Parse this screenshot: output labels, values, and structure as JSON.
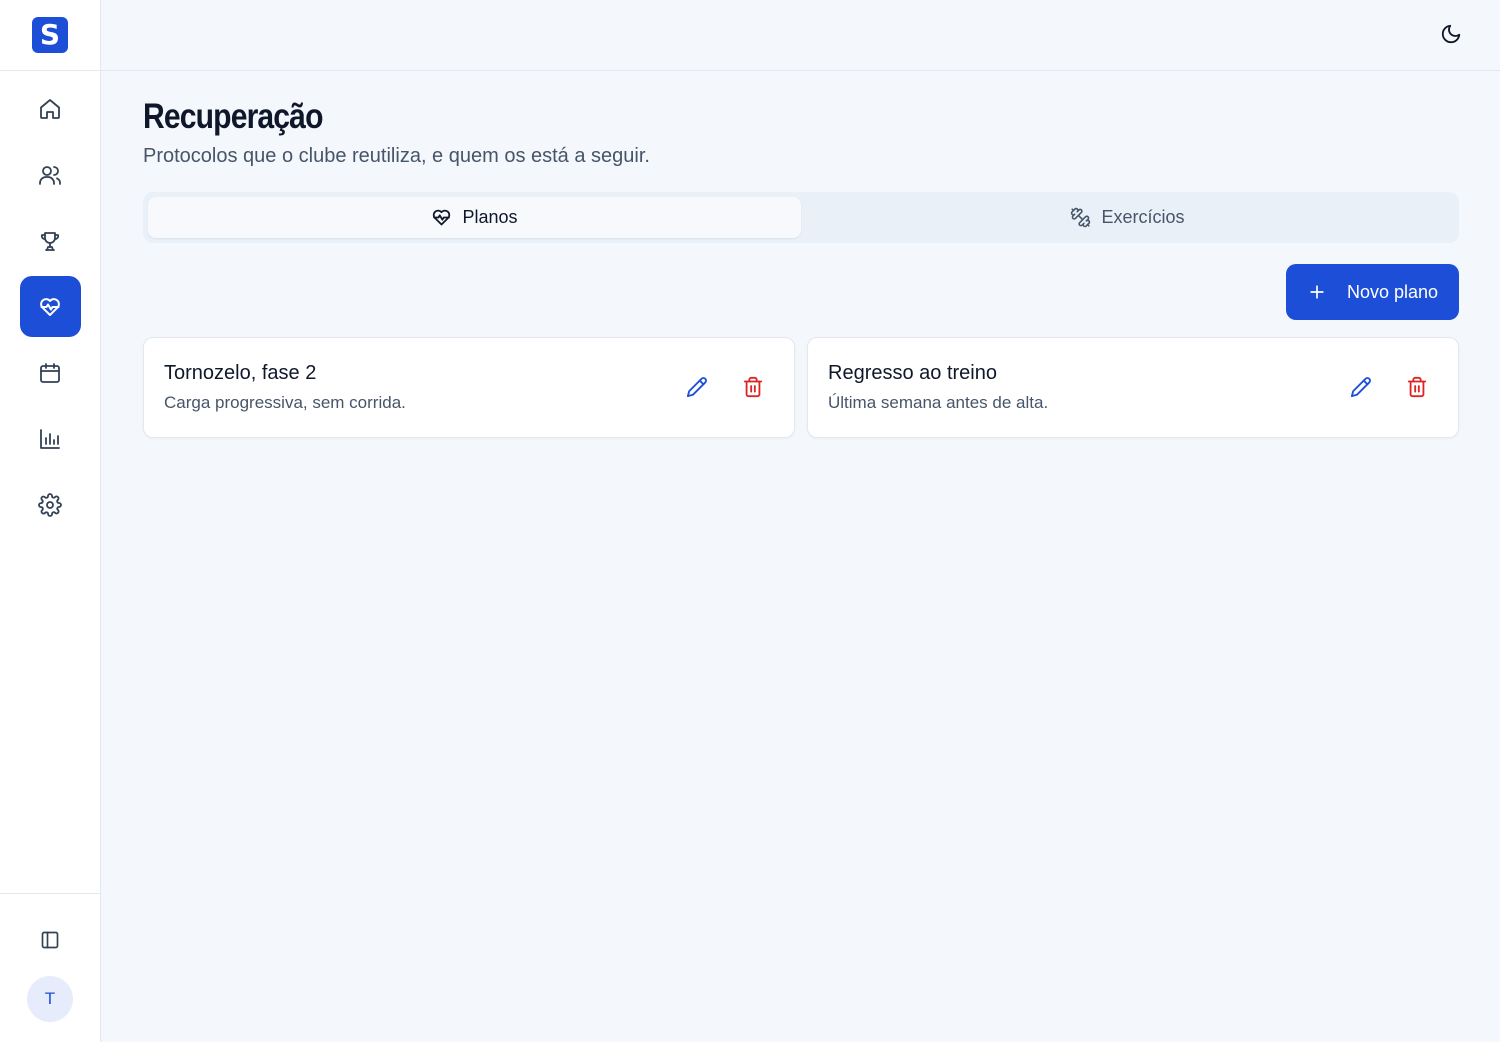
{
  "sidebar": {
    "logo": "S",
    "nav": [
      {
        "icon": "home-icon",
        "active": false
      },
      {
        "icon": "users-icon",
        "active": false
      },
      {
        "icon": "trophy-icon",
        "active": false
      },
      {
        "icon": "heart-pulse-icon",
        "active": true
      },
      {
        "icon": "calendar-icon",
        "active": false
      },
      {
        "icon": "bar-chart-icon",
        "active": false
      },
      {
        "icon": "settings-icon",
        "active": false
      }
    ],
    "avatar_initial": "T"
  },
  "header": {
    "theme_icon": "moon-icon"
  },
  "page": {
    "title": "Recuperação",
    "subtitle": "Protocolos que o clube reutiliza, e quem os está a seguir."
  },
  "tabs": [
    {
      "label": "Planos",
      "icon": "heart-pulse-icon",
      "active": true
    },
    {
      "label": "Exercícios",
      "icon": "dumbbell-icon",
      "active": false
    }
  ],
  "actions": {
    "new_plan_label": "Novo plano"
  },
  "plans": [
    {
      "title": "Tornozelo, fase 2",
      "description": "Carga progressiva, sem corrida."
    },
    {
      "title": "Regresso ao treino",
      "description": "Última semana antes de alta."
    }
  ],
  "colors": {
    "accent": "#1d4ed8",
    "danger": "#dc2626",
    "background": "#f4f7fb"
  }
}
